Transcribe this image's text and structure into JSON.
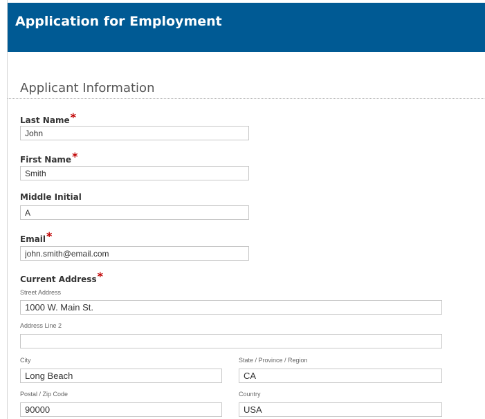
{
  "header": {
    "title": "Application for Employment"
  },
  "section": {
    "title": "Applicant Information"
  },
  "fields": {
    "last_name": {
      "label": "Last Name",
      "value": "John"
    },
    "first_name": {
      "label": "First Name",
      "value": "Smith"
    },
    "middle_initial": {
      "label": "Middle Initial",
      "value": "A"
    },
    "email": {
      "label": "Email",
      "value": "john.smith@email.com"
    }
  },
  "address": {
    "label": "Current Address",
    "street": {
      "label": "Street Address",
      "value": "1000 W. Main St."
    },
    "line2": {
      "label": "Address Line 2",
      "value": ""
    },
    "city": {
      "label": "City",
      "value": "Long Beach"
    },
    "state": {
      "label": "State / Province / Region",
      "value": "CA"
    },
    "postal": {
      "label": "Postal / Zip Code",
      "value": "90000"
    },
    "country": {
      "label": "Country",
      "value": "USA"
    }
  },
  "required_marker": "*"
}
